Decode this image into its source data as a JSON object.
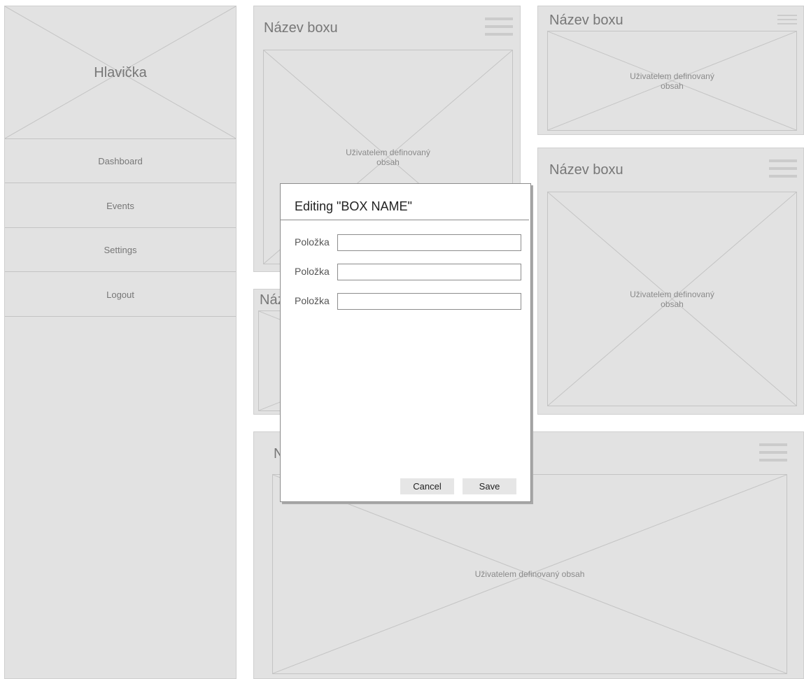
{
  "sidebar": {
    "header_label": "Hlavička",
    "items": [
      {
        "label": "Dashboard"
      },
      {
        "label": "Events"
      },
      {
        "label": "Settings"
      },
      {
        "label": "Logout"
      }
    ]
  },
  "boxes": [
    {
      "title": "Název boxu",
      "content": "Uživatelem definovaný obsah"
    },
    {
      "title": "Název boxu",
      "content": "Uživatelem definovaný obsah"
    },
    {
      "title": "Název boxu",
      "content": "Uživatelem definovaný obsah"
    },
    {
      "title": "Náz",
      "content": ""
    },
    {
      "title": "N",
      "content": "Uživatelem definovaný obsah"
    }
  ],
  "modal": {
    "title": "Editing \"BOX NAME\"",
    "fields": [
      {
        "label": "Položka",
        "value": ""
      },
      {
        "label": "Položka",
        "value": ""
      },
      {
        "label": "Položka",
        "value": ""
      }
    ],
    "cancel_label": "Cancel",
    "save_label": "Save"
  },
  "colors": {
    "panel_bg": "#e2e2e2",
    "placeholder_line": "#c4c4c4",
    "modal_border": "#8c8c8c",
    "button_bg": "#e6e6e6"
  },
  "icons": [
    "hamburger-menu-icon"
  ]
}
